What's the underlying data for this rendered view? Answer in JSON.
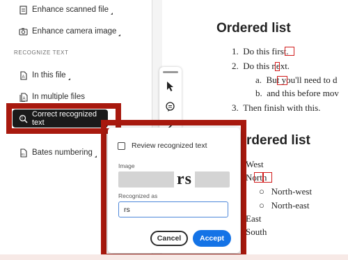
{
  "tools_panel": {
    "items": [
      {
        "label": "Enhance scanned file",
        "icon": "scan-icon"
      },
      {
        "label": "Enhance camera image",
        "icon": "camera-icon"
      }
    ],
    "section_label": "RECOGNIZE TEXT",
    "recognize_items": [
      {
        "label": "In this file",
        "icon": "file-text-icon"
      },
      {
        "label": "In multiple files",
        "icon": "files-icon"
      }
    ],
    "active_item": {
      "label": "Correct recognized text",
      "icon": "magnify-text-icon"
    },
    "bates_item": {
      "label": "Bates numbering",
      "icon": "bates-icon"
    }
  },
  "document": {
    "heading1": "Ordered list",
    "list": [
      {
        "marker": "1.",
        "text": "Do this first."
      },
      {
        "marker": "2.",
        "text": "Do this next."
      },
      {
        "marker": "a.",
        "text": "But you'll need to d"
      },
      {
        "marker": "b.",
        "text": "and this before mov"
      },
      {
        "marker": "3.",
        "text": "Then finish with this."
      }
    ],
    "heading2": "rdered list",
    "list2": [
      {
        "marker": "",
        "text": "West"
      },
      {
        "marker": "",
        "text": "North"
      },
      {
        "marker": "○",
        "text": "North-west"
      },
      {
        "marker": "○",
        "text": "North-east"
      },
      {
        "marker": "",
        "text": "East"
      },
      {
        "marker": "",
        "text": "South"
      }
    ]
  },
  "dialog": {
    "review_label": "Review recognized text",
    "image_label": "Image",
    "image_text": "rs",
    "recognized_label": "Recognized as",
    "recognized_value": "rs",
    "cancel_label": "Cancel",
    "accept_label": "Accept"
  },
  "colors": {
    "highlight": "#a8190e",
    "accent": "#1473e6",
    "active_bg": "#1a1a1a"
  }
}
